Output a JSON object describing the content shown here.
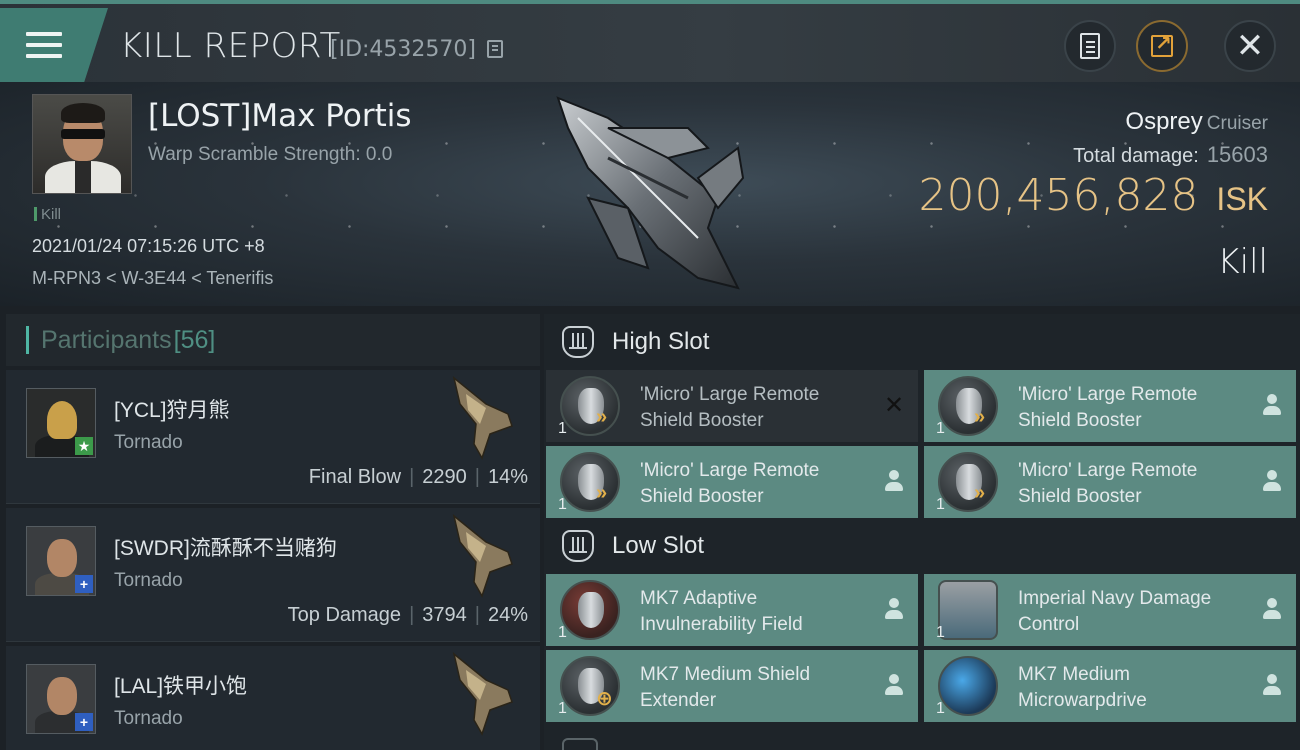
{
  "header": {
    "title": "KILL REPORT",
    "kill_id": "[ID:4532570]"
  },
  "victim": {
    "name": "[LOST]Max Portis",
    "warp_scramble": "Warp Scramble Strength: 0.0",
    "tag": "Kill",
    "datetime": "2021/01/24 07:15:26 UTC +8",
    "location": "M-RPN3 < W-3E44 < Tenerifis",
    "ship": "Osprey",
    "ship_class": "Cruiser",
    "total_damage_label": "Total damage:",
    "total_damage": "15603",
    "isk_value": "200,456,828",
    "isk_unit": "ISK",
    "result": "Kill"
  },
  "participants": {
    "label": "Participants",
    "count": "[56]",
    "rows": [
      {
        "name": "[YCL]狩月熊",
        "ship": "Tornado",
        "role": "Final Blow",
        "damage": "2290",
        "percent": "14%",
        "badge": "★",
        "badge_color": "#3c9a4a"
      },
      {
        "name": "[SWDR]流酥酥不当赌狗",
        "ship": "Tornado",
        "role": "Top Damage",
        "damage": "3794",
        "percent": "24%",
        "badge": "+",
        "badge_color": "#2f5fc0"
      },
      {
        "name": "[LAL]铁甲小饱",
        "ship": "Tornado",
        "role": "",
        "damage": "",
        "percent": "",
        "badge": "+",
        "badge_color": "#2f5fc0"
      }
    ]
  },
  "fitting": {
    "high_slot": {
      "label": "High Slot",
      "modules": [
        {
          "name": "'Micro' Large Remote Shield Booster",
          "qty": "1",
          "state": "destroyed"
        },
        {
          "name": "'Micro' Large Remote Shield Booster",
          "qty": "1",
          "state": "dropped"
        },
        {
          "name": "'Micro' Large Remote Shield Booster",
          "qty": "1",
          "state": "dropped"
        },
        {
          "name": "'Micro' Large Remote Shield Booster",
          "qty": "1",
          "state": "dropped"
        }
      ]
    },
    "low_slot": {
      "label": "Low Slot",
      "modules": [
        {
          "name": "MK7 Adaptive Invulnerability Field",
          "qty": "1",
          "state": "dropped"
        },
        {
          "name": "Imperial Navy Damage Control",
          "qty": "1",
          "state": "dropped"
        },
        {
          "name": "MK7 Medium Shield Extender",
          "qty": "1",
          "state": "dropped"
        },
        {
          "name": "MK7 Medium Microwarpdrive",
          "qty": "1",
          "state": "dropped"
        }
      ]
    }
  },
  "colors": {
    "accent": "#4fb6a4",
    "dropped_module_bg": "#5c8a82",
    "isk": "#e6c386"
  },
  "icons": [
    "menu-icon",
    "clipboard-icon",
    "share-icon",
    "close-icon",
    "high-slot-icon",
    "low-slot-icon",
    "person-icon",
    "destroyed-x-icon"
  ]
}
